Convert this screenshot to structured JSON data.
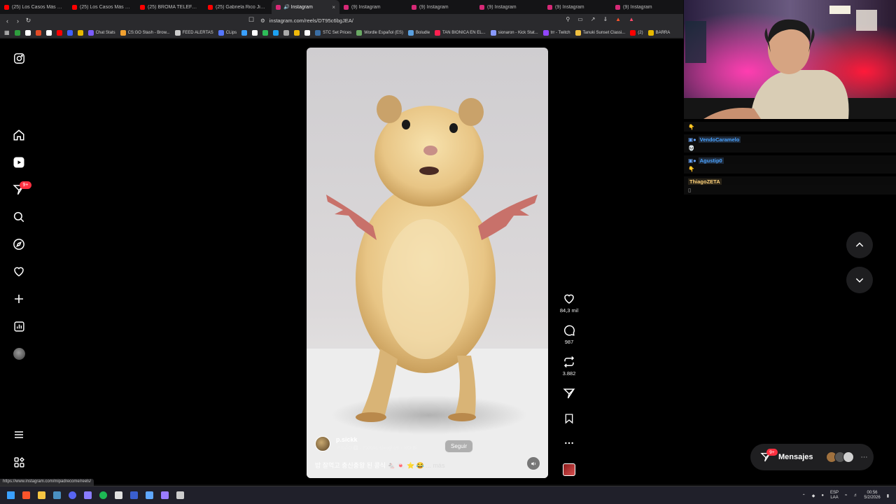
{
  "browser": {
    "tabs": [
      {
        "title": "(25) Los Casos Más Oscuros",
        "color": "#ff0000",
        "active": false
      },
      {
        "title": "(25) Los Casos Más Perturb",
        "color": "#ff0000",
        "active": false
      },
      {
        "title": "(25) BROMA TELEFONICA:",
        "color": "#ff0000",
        "active": false
      },
      {
        "title": "(25) Gabriela Rico Jiménez",
        "color": "#ff0000",
        "active": false
      },
      {
        "title": "🔊 Instagram",
        "color": "#d62976",
        "active": true
      },
      {
        "title": "(9) Instagram",
        "color": "#d62976",
        "active": false
      },
      {
        "title": "(9) Instagram",
        "color": "#d62976",
        "active": false
      },
      {
        "title": "(9) Instagram",
        "color": "#d62976",
        "active": false
      },
      {
        "title": "(9) Instagram",
        "color": "#d62976",
        "active": false
      },
      {
        "title": "(9) Instagram",
        "color": "#d62976",
        "active": false
      }
    ],
    "url": "instagram.com/reels/DT95c6bgJEA/",
    "bookmarks": [
      {
        "label": "",
        "color": "#2e9e3e"
      },
      {
        "label": "",
        "color": "#ffffff"
      },
      {
        "label": "",
        "color": "#e34c26"
      },
      {
        "label": "",
        "color": "#ffffff"
      },
      {
        "label": "",
        "color": "#ff0000"
      },
      {
        "label": "",
        "color": "#4060ff"
      },
      {
        "label": "",
        "color": "#e6b800"
      },
      {
        "label": "Chat Stats",
        "color": "#7b5cff"
      },
      {
        "label": "CS:GO Stash - Brow...",
        "color": "#f0a030"
      },
      {
        "label": "FEED ALERTAS",
        "color": "#cccccc"
      },
      {
        "label": "CLips",
        "color": "#5577ff"
      },
      {
        "label": "",
        "color": "#3aa0ff"
      },
      {
        "label": "",
        "color": "#ffffff"
      },
      {
        "label": "",
        "color": "#2ebd59"
      },
      {
        "label": "",
        "color": "#1da1f2"
      },
      {
        "label": "",
        "color": "#aaaaaa"
      },
      {
        "label": "",
        "color": "#f0b90b"
      },
      {
        "label": "",
        "color": "#ffffff"
      },
      {
        "label": "STC Set Prices",
        "color": "#3a6ea5"
      },
      {
        "label": "Wordle Español (ES)",
        "color": "#6aaa64"
      },
      {
        "label": "Boludle",
        "color": "#5aa0e0"
      },
      {
        "label": "TAN BIONICA EN EL...",
        "color": "#ff2050"
      },
      {
        "label": "sionaron - Kick Stat...",
        "color": "#8899ff"
      },
      {
        "label": "trr - Twitch",
        "color": "#9146ff"
      },
      {
        "label": "Tanuki Sunset Classi...",
        "color": "#f0c040"
      },
      {
        "label": "(2)",
        "color": "#ff0000"
      },
      {
        "label": "BARRA",
        "color": "#e6b800"
      }
    ],
    "status_url": "https://www.instagram.com/mipadrecome/reels/"
  },
  "sidebar": {
    "items": [
      "instagram-logo",
      "home-icon",
      "reels-icon",
      "messages-icon",
      "search-icon",
      "explore-icon",
      "notifications-icon",
      "create-icon",
      "dashboard-icon",
      "profile-avatar",
      "menu-icon",
      "also-from-meta-icon"
    ],
    "messages_badge": "9+"
  },
  "reel": {
    "author": "p.sickk",
    "music": "↗ DÃO 🅴 · ZXKAI, slxughter · NO B/",
    "follow_label": "Seguir",
    "caption": "밥 잘먹고 충신충왕 된 콩식 🐁 🍬 ⭐ 😂",
    "more_label": "... más",
    "likes": "84,3 mil",
    "comments": "987",
    "reposts": "3.882"
  },
  "messages": {
    "label": "Mensajes",
    "badge": "9+"
  },
  "chat": {
    "messages": [
      {
        "user": "",
        "text": "👇",
        "color": "#ffffff"
      },
      {
        "user": "VendoCaramelo",
        "text": "",
        "color": "#4aa3ff"
      },
      {
        "user": "",
        "text": "💀",
        "color": "#ffffff"
      },
      {
        "user": "Agustip0",
        "text": "",
        "color": "#4aa3ff"
      },
      {
        "user": "",
        "text": "👇",
        "color": "#ffffff"
      },
      {
        "user": "ThiagoZETA",
        "text": "",
        "color": "#ffd27a"
      },
      {
        "user": "",
        "text": "▯",
        "color": "#ffffff"
      }
    ]
  },
  "taskbar": {
    "apps": [
      {
        "name": "windows-start",
        "color": "#3aa0ff"
      },
      {
        "name": "brave",
        "color": "#fb542b"
      },
      {
        "name": "file-explorer",
        "color": "#f5c542"
      },
      {
        "name": "steam",
        "color": "#4a90c2"
      },
      {
        "name": "discord",
        "color": "#5865f2"
      },
      {
        "name": "chat-app",
        "color": "#8a7cff"
      },
      {
        "name": "spotify",
        "color": "#1db954"
      },
      {
        "name": "obs",
        "color": "#e0e0e0"
      },
      {
        "name": "app-blue",
        "color": "#3a5fcf"
      },
      {
        "name": "app-game",
        "color": "#5fa8ff"
      },
      {
        "name": "app-purple",
        "color": "#9a7cff"
      },
      {
        "name": "app-arrow",
        "color": "#cccccc"
      }
    ],
    "lang_top": "ESP",
    "lang_bottom": "LAA",
    "time": "00:56",
    "date": "5/2/2026"
  }
}
